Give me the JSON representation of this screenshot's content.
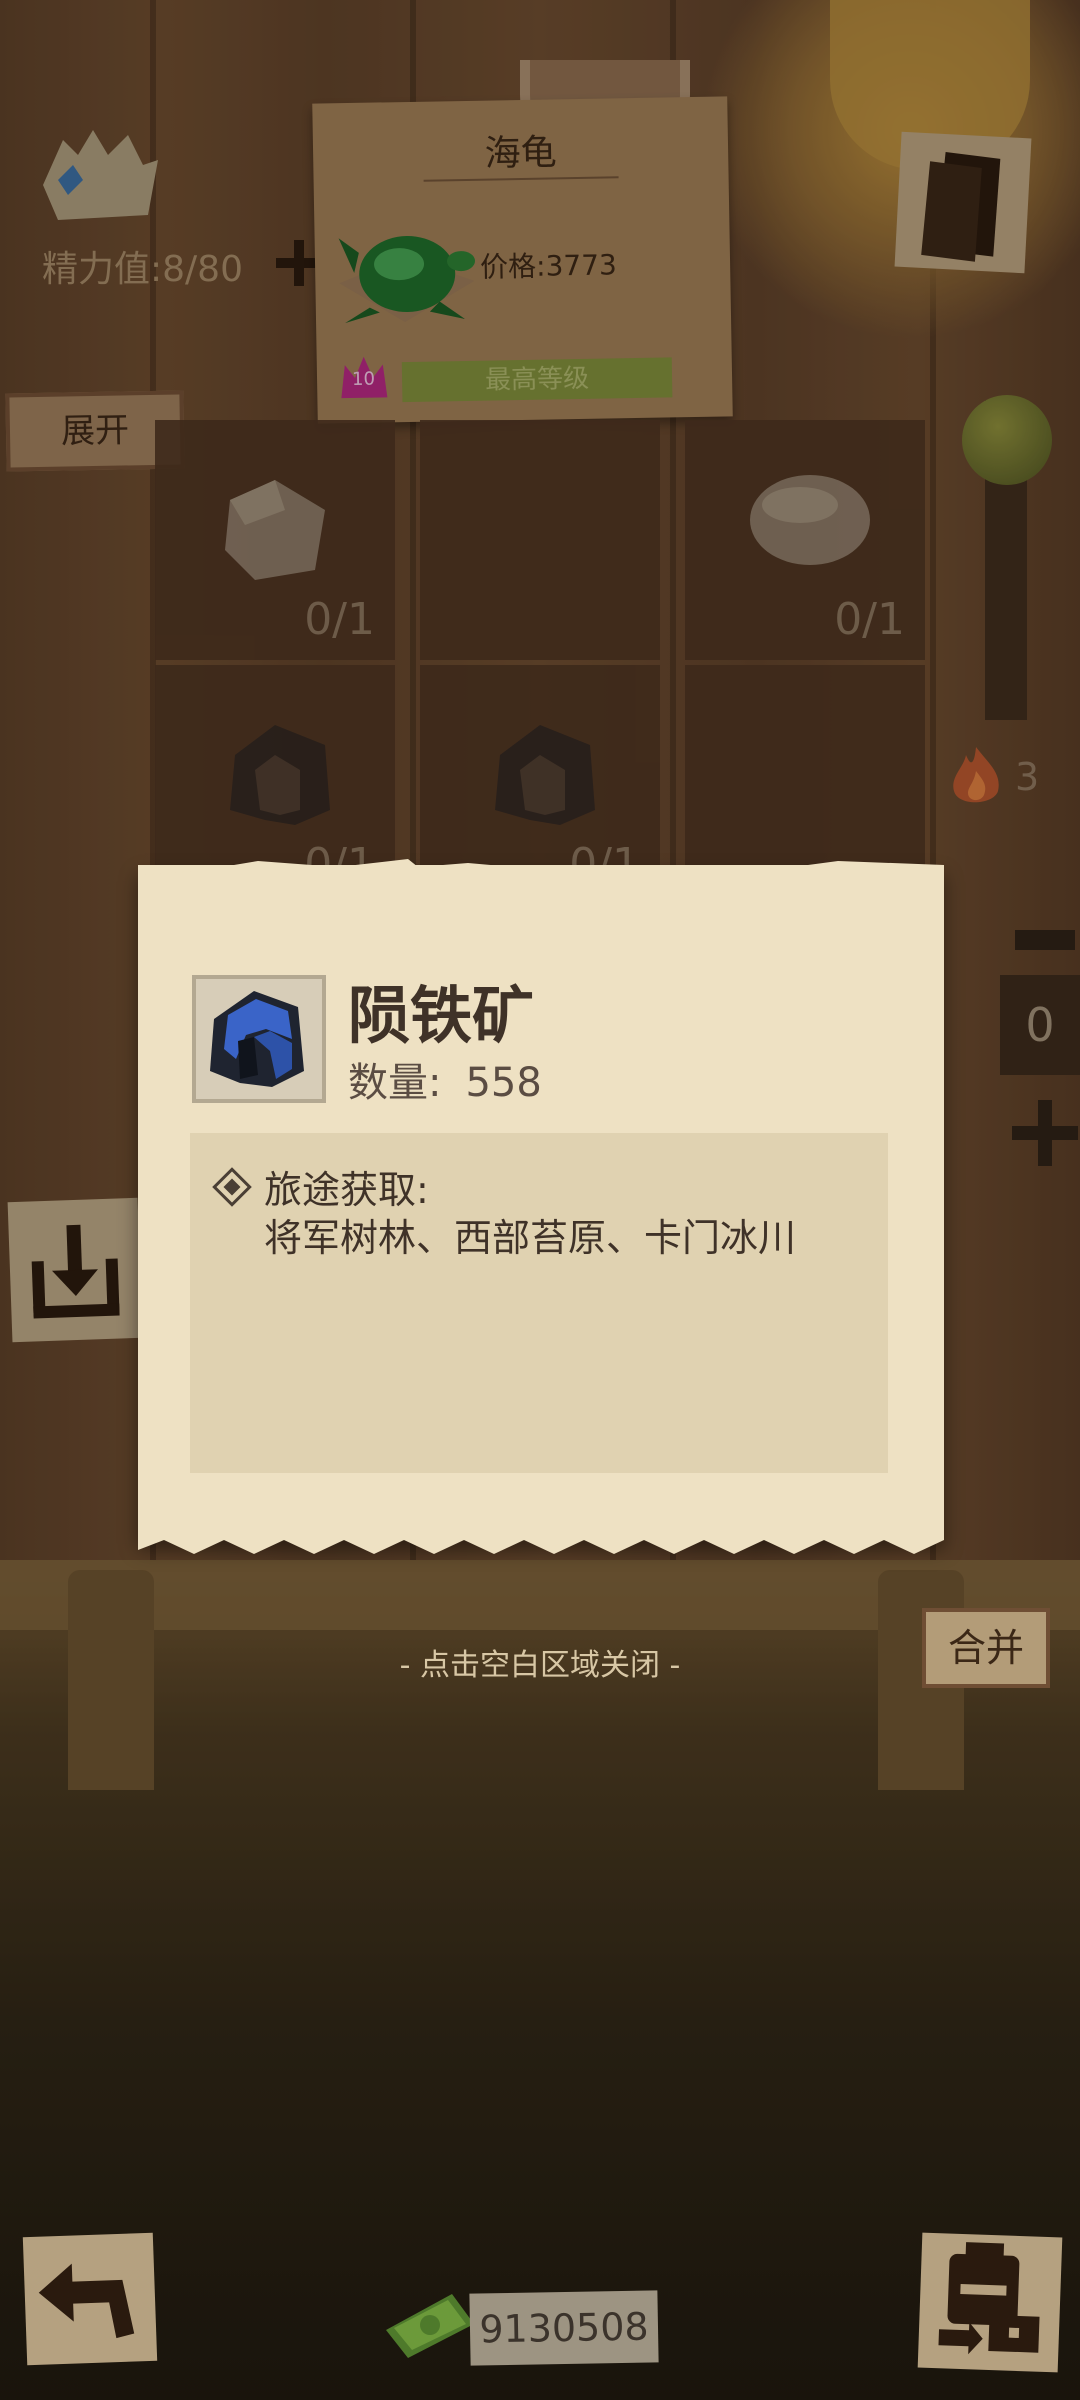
{
  "hud": {
    "stamina_label": "精力值:8/80"
  },
  "item_card": {
    "title": "海龟",
    "price_label": "价格:3773",
    "level_number": "10",
    "max_level_label": "最高等级"
  },
  "left_menu": {
    "expand_label": "展开"
  },
  "slots": [
    {
      "count": "0/1",
      "object": "stone-icon"
    },
    {
      "count": "",
      "object": ""
    },
    {
      "count": "0/1",
      "object": "bowl-icon"
    },
    {
      "count": "0/1",
      "object": "ore-icon"
    },
    {
      "count": "0/1",
      "object": "ore-icon"
    },
    {
      "count": "",
      "object": ""
    }
  ],
  "side_panel": {
    "fire_count": "3",
    "counter_value": "0"
  },
  "popup": {
    "item_name": "陨铁矿",
    "quantity_label": "数量:",
    "quantity_value": "558",
    "source_title": "旅途获取:",
    "source_list": "将军树林、西部苔原、卡门冰川"
  },
  "close_hint": "- 点击空白区域关闭 -",
  "merge_label": "合并",
  "currency": {
    "amount": "9130508"
  },
  "colors": {
    "popup_bg": "#eee1c3",
    "info_bg": "#e0d2b1",
    "ore_blue": "#3a64c8",
    "level_bar": "#7d8a3a"
  }
}
